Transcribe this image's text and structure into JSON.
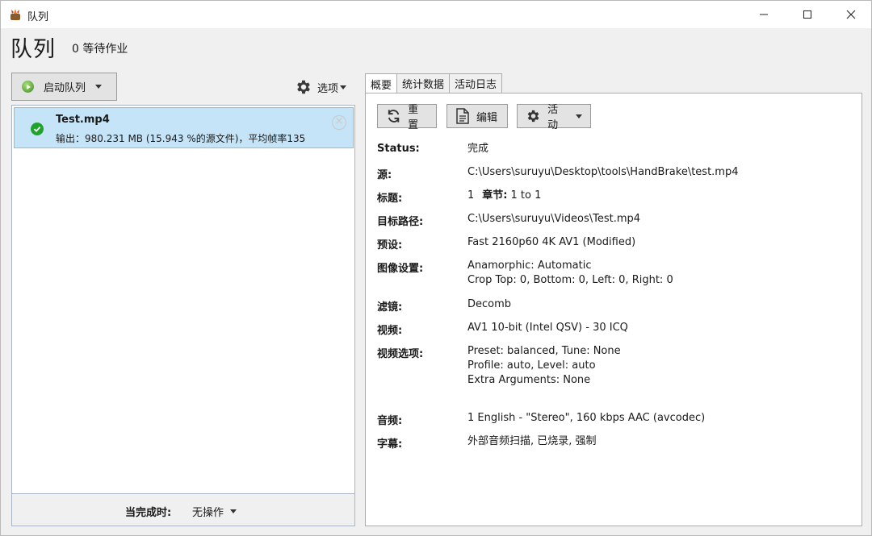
{
  "window": {
    "title": "队列"
  },
  "header": {
    "title": "队列",
    "pending": "0 等待作业"
  },
  "toolbar": {
    "start_queue": "启动队列",
    "options": "选项"
  },
  "queue": {
    "jobs": [
      {
        "name": "Test.mp4",
        "detail": "输出：980.231 MB (15.943 %的源文件)，平均帧率135",
        "status": "completed"
      }
    ]
  },
  "footer": {
    "when_done_label": "当完成时:",
    "when_done_value": "无操作"
  },
  "tabs": [
    {
      "label": "概要",
      "active": true
    },
    {
      "label": "统计数据",
      "active": false
    },
    {
      "label": "活动日志",
      "active": false
    }
  ],
  "actions": {
    "reset": "重置",
    "edit": "编辑",
    "activity": "活动"
  },
  "summary": {
    "status": {
      "label": "Status:",
      "value": "完成"
    },
    "source": {
      "label": "源:",
      "value": "C:\\Users\\suruyu\\Desktop\\tools\\HandBrake\\test.mp4"
    },
    "title": {
      "label": "标题:",
      "title_value": "1",
      "chapters_label": "章节:",
      "chapters_value": "1 to 1"
    },
    "destination": {
      "label": "目标路径:",
      "value": "C:\\Users\\suruyu\\Videos\\Test.mp4"
    },
    "preset": {
      "label": "预设:",
      "value": "Fast 2160p60 4K AV1 (Modified)"
    },
    "picture": {
      "label": "图像设置:",
      "line1": "Anamorphic: Automatic",
      "line2": "Crop Top: 0, Bottom: 0, Left: 0, Right: 0"
    },
    "filters": {
      "label": "滤镜:",
      "value": "Decomb"
    },
    "video": {
      "label": "视频:",
      "value": "AV1 10-bit (Intel QSV) - 30 ICQ"
    },
    "video_options": {
      "label": "视频选项:",
      "line1": "Preset: balanced, Tune: None",
      "line2": "Profile: auto, Level: auto",
      "line3": "Extra Arguments: None"
    },
    "audio": {
      "label": "音频:",
      "value": "1 English - \"Stereo\", 160 kbps AAC (avcodec)"
    },
    "subtitles": {
      "label": "字幕:",
      "value": "外部音频扫描, 已烧录, 强制"
    }
  },
  "colors": {
    "selection": "#c5e4f7",
    "selection_border": "#7fc1ea",
    "success": "#20a32c",
    "window_bg": "#f0f0f0"
  }
}
